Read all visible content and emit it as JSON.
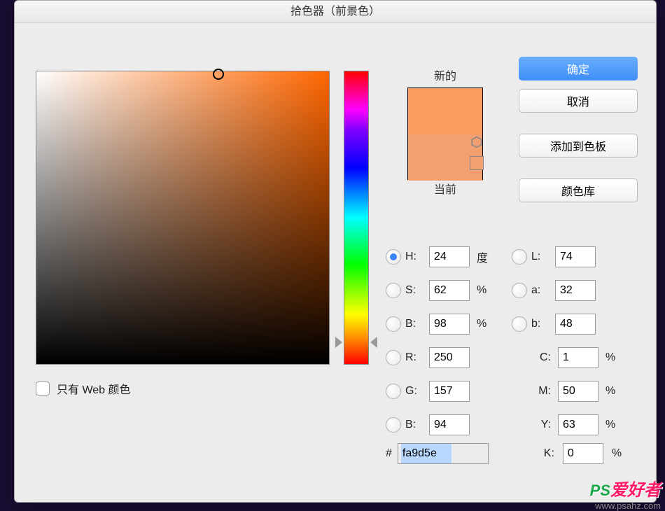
{
  "title": "拾色器（前景色）",
  "preview": {
    "new_label": "新的",
    "current_label": "当前"
  },
  "buttons": {
    "ok": "确定",
    "cancel": "取消",
    "add_swatch": "添加到色板",
    "color_lib": "颜色库"
  },
  "hsb": {
    "h_label": "H:",
    "h_value": "24",
    "h_unit": "度",
    "s_label": "S:",
    "s_value": "62",
    "s_unit": "%",
    "b_label": "B:",
    "b_value": "98",
    "b_unit": "%"
  },
  "lab": {
    "l_label": "L:",
    "l_value": "74",
    "a_label": "a:",
    "a_value": "32",
    "b_label": "b:",
    "b_value": "48"
  },
  "rgb": {
    "r_label": "R:",
    "r_value": "250",
    "g_label": "G:",
    "g_value": "157",
    "b_label": "B:",
    "b_value": "94"
  },
  "cmyk": {
    "c_label": "C:",
    "c_value": "1",
    "c_unit": "%",
    "m_label": "M:",
    "m_value": "50",
    "m_unit": "%",
    "y_label": "Y:",
    "y_value": "63",
    "y_unit": "%",
    "k_label": "K:",
    "k_value": "0",
    "k_unit": "%"
  },
  "hex": {
    "label": "#",
    "value": "fa9d5e"
  },
  "web_only": "只有 Web 颜色",
  "watermark": {
    "ps": "PS",
    "cn": "爱好者",
    "url": "www.psahz.com"
  },
  "colors": {
    "new": "#fa9d5e",
    "current": "#f2a070"
  }
}
